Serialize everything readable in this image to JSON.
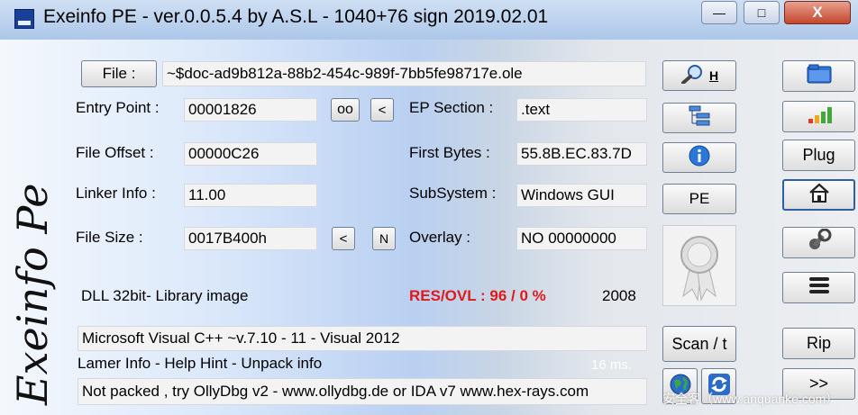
{
  "window": {
    "title": "Exeinfo PE - ver.0.0.5.4  by A.S.L -  1040+76 sign  2019.02.01"
  },
  "controls": {
    "minimize": "—",
    "maximize": "□",
    "close": "X"
  },
  "logo": {
    "text": "Exeinfo Pe"
  },
  "file": {
    "button": "File :",
    "path": "~$doc-ad9b812a-88b2-454c-989f-7bb5fe98717e.ole"
  },
  "entry_point": {
    "label": "Entry Point :",
    "value": "00001826",
    "btn1": "oo",
    "btn2": "<"
  },
  "ep_section": {
    "label": "EP Section :",
    "value": ".text"
  },
  "file_offset": {
    "label": "File Offset :",
    "value": "00000C26"
  },
  "first_bytes": {
    "label": "First Bytes :",
    "value": "55.8B.EC.83.7D"
  },
  "linker_info": {
    "label": "Linker Info :",
    "value": "11.00"
  },
  "subsystem": {
    "label": "SubSystem :",
    "value": "Windows GUI"
  },
  "file_size": {
    "label": "File Size :",
    "value": "0017B400h",
    "btn1": "<",
    "btn2": "N"
  },
  "overlay": {
    "label": "Overlay :",
    "value": "NO   00000000"
  },
  "dll_info": "DLL 32bit- Library image",
  "res_ovl": "RES/OVL : 96 / 0 %",
  "year": "2008",
  "detect": "Microsoft Visual C++ ~v.7.10 - 11 - Visual 2012",
  "lamer_info": "Lamer Info - Help Hint - Unpack info",
  "timing": "16 ms.",
  "hint": "Not packed , try OllyDbg v2 - www.ollydbg.de or IDA v7 www.hex-rays.com",
  "mid_buttons": {
    "h_label": "H",
    "pe": "PE",
    "scan": "Scan / t"
  },
  "right_buttons": {
    "plug": "Plug",
    "rip": "Rip",
    "next": ">>"
  },
  "watermark": "安全客（www.anquanke.com）"
}
